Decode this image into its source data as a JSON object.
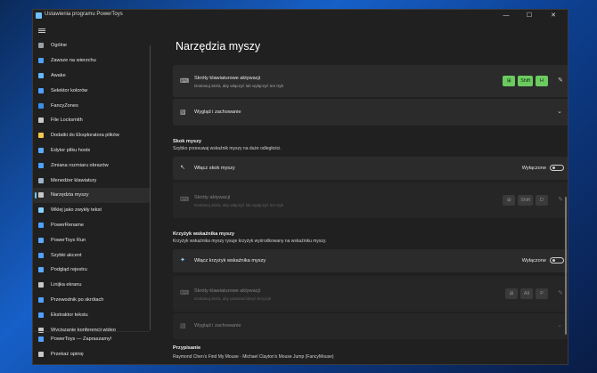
{
  "window": {
    "title": "Ustawienia programu PowerToys",
    "minimize_glyph": "—",
    "maximize_glyph": "☐",
    "close_glyph": "✕"
  },
  "nav": {
    "items": [
      {
        "label": "Ogólne",
        "icon": "gear-icon",
        "color": "#9aa0a6"
      },
      {
        "label": "Zawsze na wierzchu",
        "icon": "pin-icon",
        "color": "#4ea1ff"
      },
      {
        "label": "Awake",
        "icon": "coffee-icon",
        "color": "#62b8ff"
      },
      {
        "label": "Selektor kolorów",
        "icon": "color-picker-icon",
        "color": "#4ea1ff"
      },
      {
        "label": "FancyZones",
        "icon": "zones-icon",
        "color": "#3b8eea"
      },
      {
        "label": "File Locksmith",
        "icon": "lock-icon",
        "color": "#c7c7c7"
      },
      {
        "label": "Dodatki do Eksploratora plików",
        "icon": "folder-icon",
        "color": "#f2c94c"
      },
      {
        "label": "Edytor pliku hosts",
        "icon": "hosts-icon",
        "color": "#5aa9ff"
      },
      {
        "label": "Zmiana rozmiaru obrazów",
        "icon": "image-resize-icon",
        "color": "#4ea1ff"
      },
      {
        "label": "Menedżer klawiatury",
        "icon": "keyboard-icon",
        "color": "#9fb3c8"
      },
      {
        "label": "Narzędzia myszy",
        "icon": "mouse-icon",
        "color": "#c7c7c7"
      },
      {
        "label": "Wklej jako zwykły tekst",
        "icon": "paste-icon",
        "color": "#8ad0ff"
      },
      {
        "label": "PowerRename",
        "icon": "rename-icon",
        "color": "#4ea1ff"
      },
      {
        "label": "PowerToys Run",
        "icon": "run-icon",
        "color": "#5aa9ff"
      },
      {
        "label": "Szybki akcent",
        "icon": "accent-icon",
        "color": "#4ea1ff"
      },
      {
        "label": "Podgląd rejestru",
        "icon": "registry-icon",
        "color": "#5aa9ff"
      },
      {
        "label": "Linijka ekranu",
        "icon": "ruler-icon",
        "color": "#c7c7c7"
      },
      {
        "label": "Przewodnik po skrótach",
        "icon": "shortcut-guide-icon",
        "color": "#4ea1ff"
      },
      {
        "label": "Ekstraktor tekstu",
        "icon": "text-extract-icon",
        "color": "#4ea1ff"
      },
      {
        "label": "Wyciszanie konferencji wideo",
        "icon": "video-mute-icon",
        "color": "#c7c7c7"
      }
    ],
    "active_index": 10,
    "bottom": [
      {
        "label": "PowerToys — Zapraszamy!",
        "icon": "welcome-icon",
        "color": "#4ea1ff"
      },
      {
        "label": "Przekaż opinię",
        "icon": "feedback-icon",
        "color": "#c7c7c7"
      }
    ]
  },
  "main": {
    "heading": "Narzędzia myszy",
    "card1": {
      "title": "Skróty klawiaturowe aktywacji",
      "subtitle": "Dostosuj skrót, aby włączyć lub wyłączyć ten tryb",
      "keys": [
        "⊞",
        "Shift",
        "H"
      ]
    },
    "card2": {
      "title": "Wygląd i zachowanie"
    },
    "section_skok": {
      "title": "Skok myszy",
      "subtitle": "Szybko przesuwaj wskaźnik myszy na duże odległości.",
      "toggle_title": "Włącz skok myszy",
      "toggle_state": "Wyłączone",
      "shortcut_title": "Skróty aktywacji",
      "shortcut_subtitle": "Dostosuj skrót, aby włączyć lub wyłączyć ten tryb",
      "keys": [
        "⊞",
        "Shift",
        "D"
      ]
    },
    "section_krzyzyk": {
      "title": "Krzyżyk wskaźnika myszy",
      "subtitle": "Krzyżyk wskaźnika myszy rysuje krzyżyk wyśrodkowany na wskaźniku myszy.",
      "toggle_title": "Włącz krzyżyk wskaźnika myszy",
      "toggle_state": "Wyłączone",
      "shortcut_title": "Skróty klawiaturowe aktywacji",
      "shortcut_subtitle": "Dostosuj skrót, aby pokazać/ukryć krzyżyk",
      "keys": [
        "⊞",
        "Alt",
        "P"
      ],
      "appearance_title": "Wygląd i zachowanie"
    },
    "attribution_title": "Przypisanie",
    "attribution_text": "Raymond Chen's Find My Mouse · Michael Clayton's Mouse Jump (FancyMouse)"
  }
}
